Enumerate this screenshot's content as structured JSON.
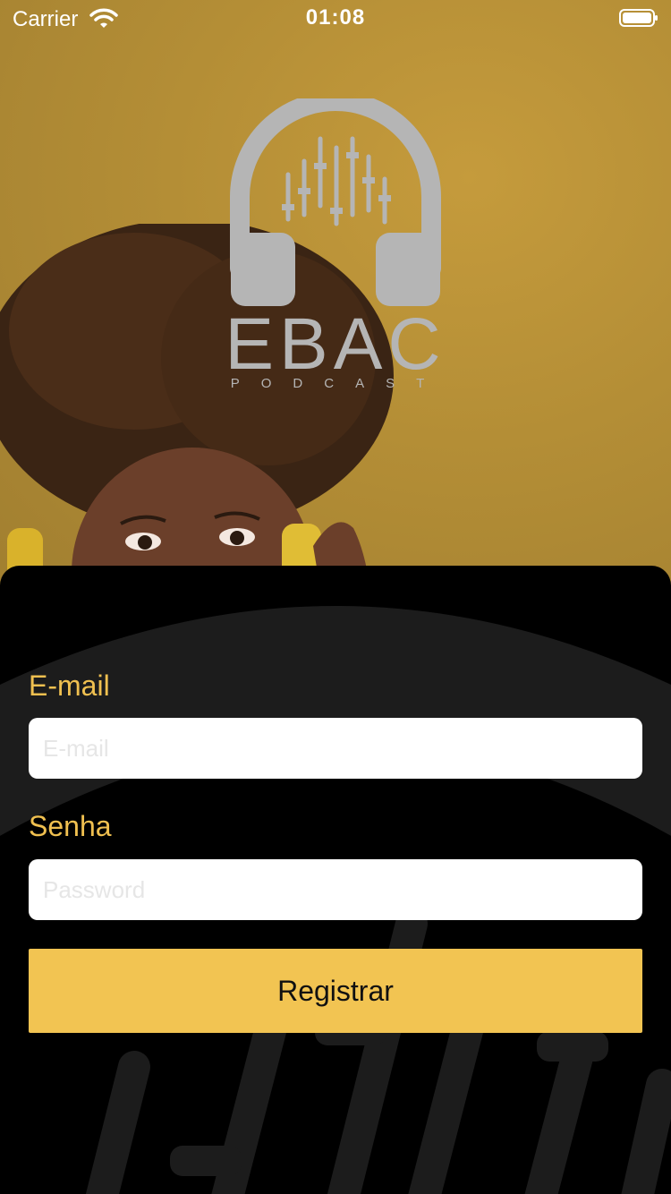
{
  "status_bar": {
    "carrier": "Carrier",
    "time": "01:08",
    "wifi_icon": "wifi-icon",
    "battery_icon": "battery-icon"
  },
  "logo": {
    "brand": "EBAC",
    "subtitle": "PODCAST",
    "icon": "headphones-equalizer-icon"
  },
  "form": {
    "email_label": "E-mail",
    "email_placeholder": "E-mail",
    "email_value": "",
    "password_label": "Senha",
    "password_placeholder": "Password",
    "password_value": "",
    "submit_label": "Registrar"
  },
  "colors": {
    "accent": "#f2c452",
    "label": "#f0c050",
    "hero_bg": "#b48e36",
    "sheet_bg": "#000000"
  }
}
